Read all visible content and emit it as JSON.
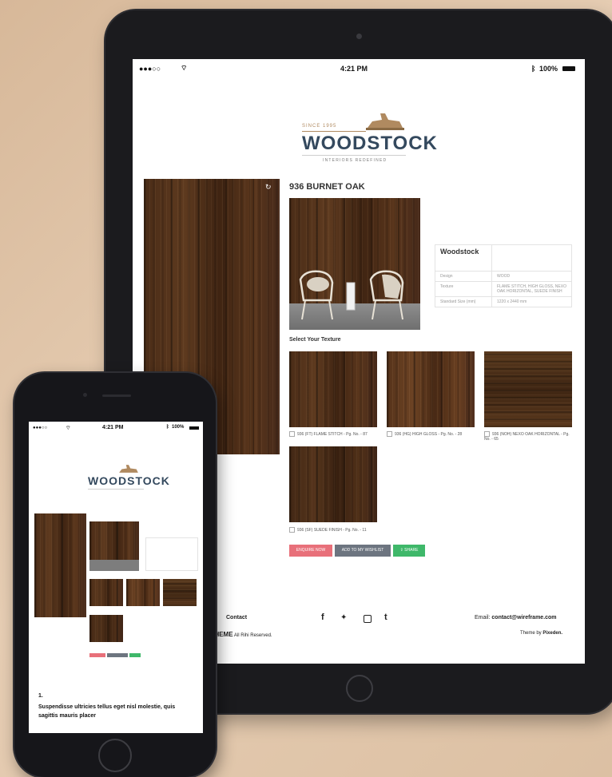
{
  "status": {
    "time": "4:21 PM",
    "battery": "100%"
  },
  "logo": {
    "since": "SINCE 1995",
    "name": "WOODSTOCK",
    "tagline": "INTERIORS REDEFINED"
  },
  "product": {
    "title": "936 BURNET OAK",
    "spec_brand": "Woodstock",
    "spec_rows": [
      {
        "label": "Design",
        "value": "WOOD"
      },
      {
        "label": "Texture",
        "value": "FLAME STITCH, HIGH GLOSS, NEXO OAK HORIZONTAL, SUEDE FINISH"
      },
      {
        "label": "Standard Size (mm)",
        "value": "1220 x 2440 mm"
      }
    ],
    "texture_heading": "Select Your Texture",
    "textures": [
      "936 (FT) FLAME STITCH - Pg. No. - 87",
      "936 (HG) HIGH GLOSS - Pg. No. - 28",
      "936 (NOH) NEXO OAK HORIZONTAL - Pg. No. - 65",
      "936 (SF) SUEDE FINISH - Pg. No. - 11"
    ],
    "buttons": {
      "enquire": "ENQUIRE NOW",
      "wishlist": "ADD TO MY WISHLIST",
      "share": "SHARE"
    }
  },
  "footer": {
    "contact": "Contact",
    "email_label": "Email:",
    "email": "contact@wireframe.com",
    "copyright_brand": "E THEME",
    "copyright_rest": "All Rihi Reserved.",
    "credit_prefix": "Theme by",
    "credit_name": "Pixeden."
  },
  "phone_content": {
    "list_number": "1.",
    "paragraph": "Suspendisse ultricies tellus eget nisl molestie, quis sagittis mauris placer"
  },
  "colors": {
    "enquire": "#e8707a",
    "wishlist": "#6d7580",
    "share": "#3fb86a",
    "logo_text": "#34495e",
    "logo_accent": "#b08a60"
  },
  "icons": [
    "signal-icon",
    "wifi-icon",
    "bluetooth-icon",
    "battery-icon",
    "refresh-icon",
    "facebook-icon",
    "twitter-icon",
    "instagram-icon",
    "tumblr-icon"
  ]
}
